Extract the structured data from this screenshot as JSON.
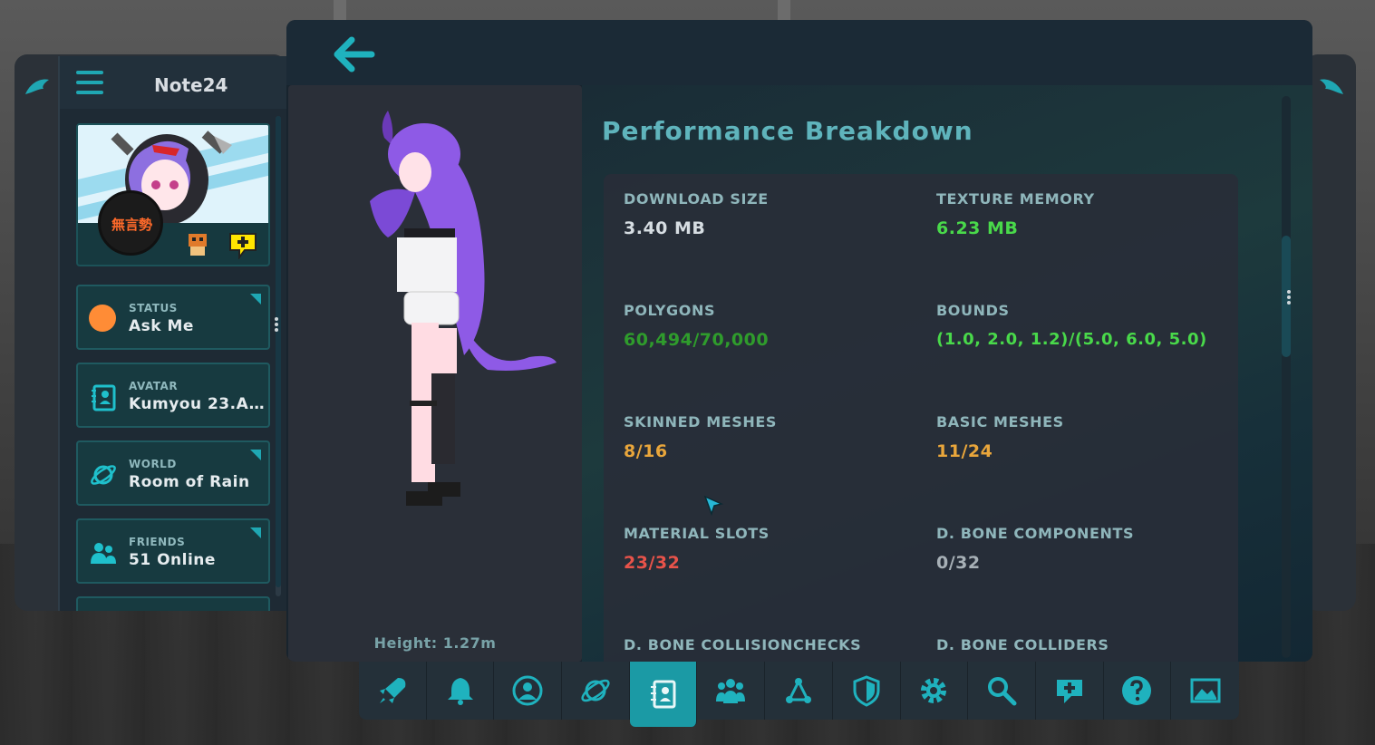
{
  "left_menu": {
    "username": "Note24",
    "profile": {
      "badge_text": "無言勢"
    },
    "cards": [
      {
        "label": "STATUS",
        "value": "Ask Me",
        "status_color": "#ff8c36",
        "icon": "status-dot-icon"
      },
      {
        "label": "AVATAR",
        "value": "Kumyou 23.A...",
        "icon": "avatar-card-icon"
      },
      {
        "label": "WORLD",
        "value": "Room of Rain",
        "icon": "planet-icon"
      },
      {
        "label": "FRIENDS",
        "value": "51 Online",
        "icon": "friends-icon"
      }
    ]
  },
  "main": {
    "preview": {
      "height_text": "Height: 1.27m"
    },
    "title": "Performance Breakdown",
    "stats": [
      {
        "label": "DOWNLOAD SIZE",
        "value": "3.40 MB",
        "color": "#d6dde2"
      },
      {
        "label": "TEXTURE MEMORY",
        "value": "6.23 MB",
        "color": "#49d94a"
      },
      {
        "label": "POLYGONS",
        "value": "60,494/70,000",
        "color": "#2f9c2c"
      },
      {
        "label": "BOUNDS",
        "value": "(1.0, 2.0, 1.2)/(5.0, 6.0, 5.0)",
        "color": "#49d94a"
      },
      {
        "label": "SKINNED MESHES",
        "value": "8/16",
        "color": "#e9a63b"
      },
      {
        "label": "BASIC MESHES",
        "value": "11/24",
        "color": "#e9a63b"
      },
      {
        "label": "MATERIAL SLOTS",
        "value": "23/32",
        "color": "#e8534a"
      },
      {
        "label": "D. BONE COMPONENTS",
        "value": "0/32",
        "color": "#a7b0b6"
      },
      {
        "label": "D. BONE COLLISIONCHECKS",
        "value": "",
        "color": "#a7b0b6"
      },
      {
        "label": "D. BONE COLLIDERS",
        "value": "",
        "color": "#a7b0b6"
      }
    ]
  },
  "toolbar": {
    "items": [
      {
        "icon": "rocket-icon"
      },
      {
        "icon": "bell-icon"
      },
      {
        "icon": "profile-icon"
      },
      {
        "icon": "worlds-icon"
      },
      {
        "icon": "avatars-icon",
        "active": true
      },
      {
        "icon": "social-icon"
      },
      {
        "icon": "groups-icon"
      },
      {
        "icon": "safety-shield-icon"
      },
      {
        "icon": "settings-gear-icon"
      },
      {
        "icon": "search-icon"
      },
      {
        "icon": "chat-add-icon"
      },
      {
        "icon": "help-icon"
      },
      {
        "icon": "gallery-icon"
      }
    ]
  },
  "colors": {
    "accent": "#1b9aa5",
    "title": "#5fb4bc"
  }
}
